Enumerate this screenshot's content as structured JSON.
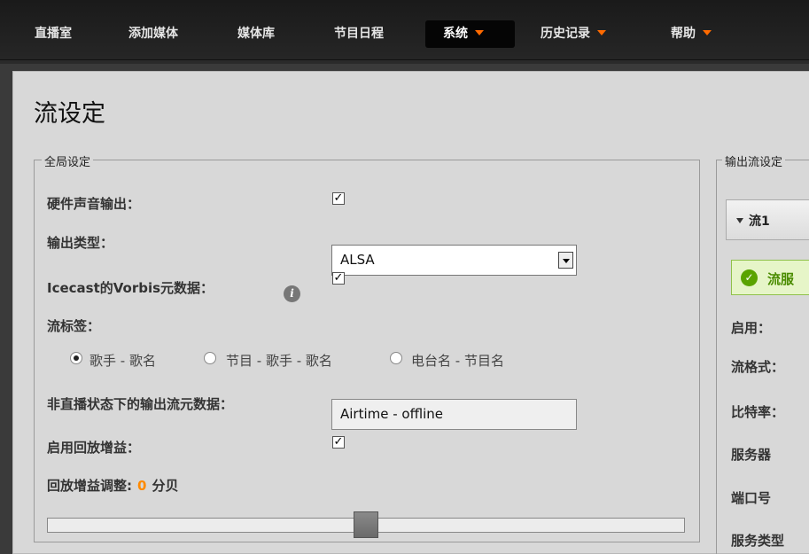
{
  "nav": {
    "items": [
      {
        "label": "直播室"
      },
      {
        "label": "添加媒体"
      },
      {
        "label": "媒体库"
      },
      {
        "label": "节目日程"
      },
      {
        "label": "系统"
      },
      {
        "label": "历史记录"
      },
      {
        "label": "帮助"
      }
    ]
  },
  "page": {
    "title": "流设定"
  },
  "global": {
    "legend": "全局设定",
    "hw_output_label": "硬件声音输出：",
    "output_type_label": "输出类型：",
    "output_type_value": "ALSA",
    "icecast_label": "Icecast的Vorbis元数据：",
    "stream_label_label": "流标签：",
    "radio_options": [
      "歌手 - 歌名",
      "节目 - 歌手 - 歌名",
      "电台名 - 节目名"
    ],
    "offline_label": "非直播状态下的输出流元数据：",
    "offline_value": "Airtime - offline",
    "replay_gain_label": "启用回放增益：",
    "replay_adjust_label": "回放增益调整:",
    "replay_adjust_value": "0",
    "replay_adjust_unit": "分贝",
    "checks": {
      "hw_output": true,
      "icecast": true,
      "replay_gain": true
    },
    "selected_radio": 0,
    "slider_level_fraction": 0.5
  },
  "output": {
    "legend": "输出流设定",
    "stream_title": "流1",
    "status_text": "流服",
    "fields": [
      "启用：",
      "流格式：",
      "比特率：",
      "服务器",
      "端口号",
      "服务类型"
    ]
  },
  "colors": {
    "accent": "#ff6a00",
    "success": "#5aa300"
  }
}
